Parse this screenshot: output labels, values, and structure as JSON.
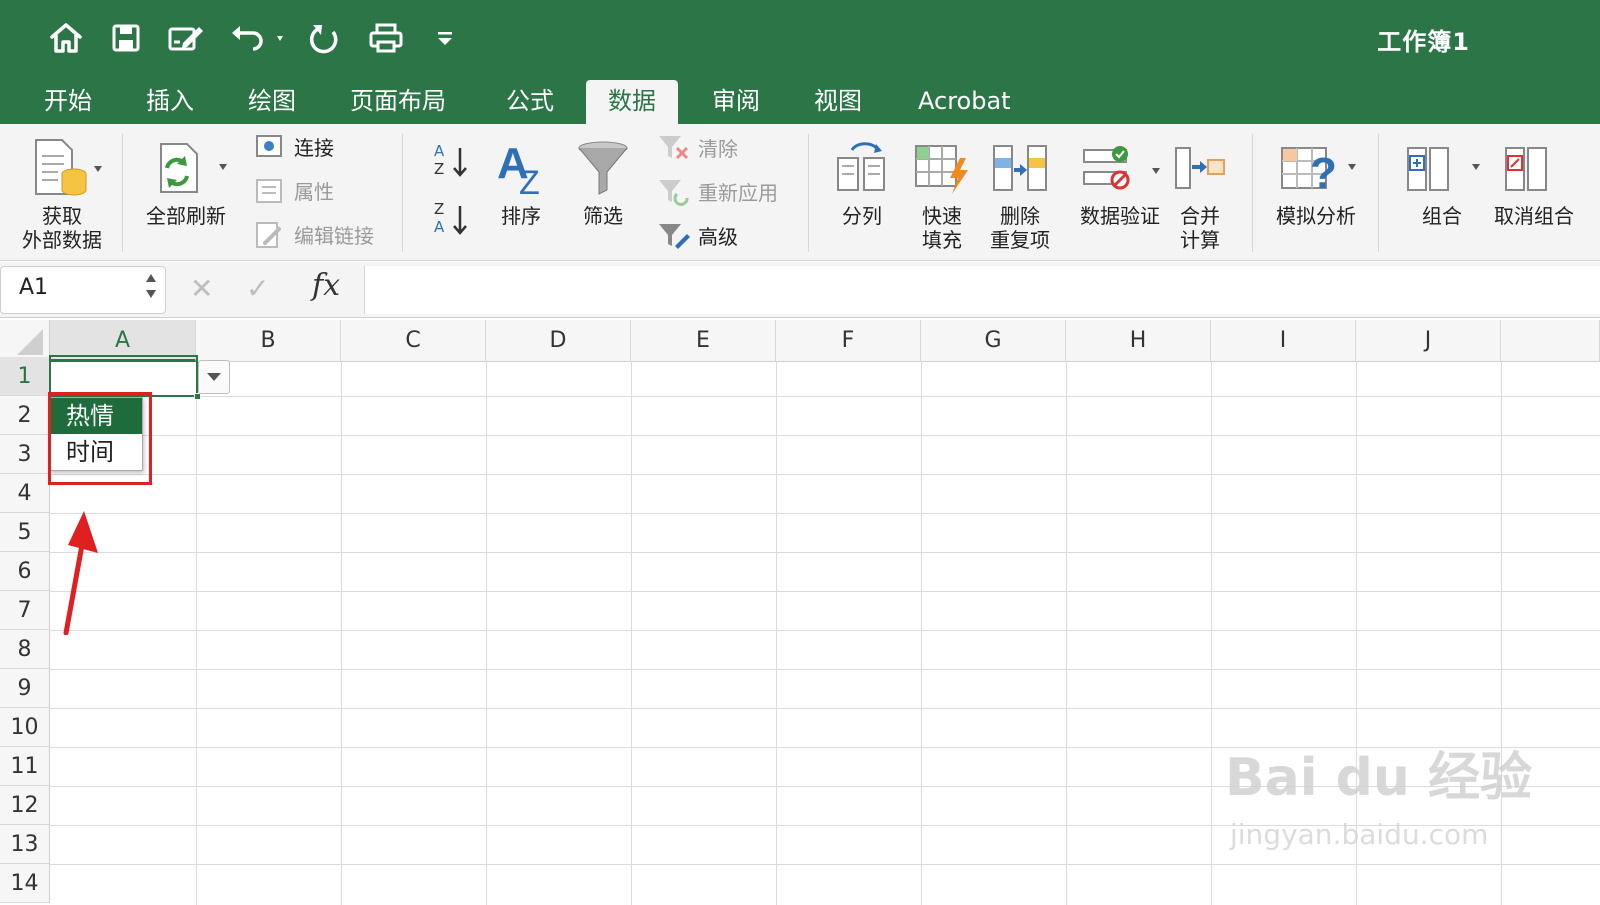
{
  "window": {
    "title": "工作簿1"
  },
  "quick_access": [
    {
      "icon": "home-icon"
    },
    {
      "icon": "save-icon"
    },
    {
      "icon": "edit-icon"
    },
    {
      "icon": "undo-icon"
    },
    {
      "icon": "redo-icon"
    },
    {
      "icon": "print-icon"
    },
    {
      "icon": "customize-icon"
    }
  ],
  "tabs": [
    {
      "label": "开始"
    },
    {
      "label": "插入"
    },
    {
      "label": "绘图"
    },
    {
      "label": "页面布局"
    },
    {
      "label": "公式"
    },
    {
      "label": "数据",
      "active": true
    },
    {
      "label": "审阅"
    },
    {
      "label": "视图"
    },
    {
      "label": "Acrobat"
    }
  ],
  "ribbon": {
    "get_external_data": "获取\n外部数据",
    "refresh_all": "全部刷新",
    "connections": "连接",
    "properties": "属性",
    "edit_links": "编辑链接",
    "sort": "排序",
    "filter": "筛选",
    "clear": "清除",
    "reapply": "重新应用",
    "advanced": "高级",
    "text_to_columns": "分列",
    "flash_fill": "快速\n填充",
    "remove_duplicates": "删除\n重复项",
    "data_validation": "数据验证",
    "consolidate": "合并\n计算",
    "what_if": "模拟分析",
    "group": "组合",
    "ungroup": "取消组合",
    "sort_az_top": "A",
    "sort_az_bottom": "Z",
    "sort_za_top": "Z",
    "sort_za_bottom": "A"
  },
  "formula_bar": {
    "name_box": "A1",
    "fx_label": "fx",
    "formula": ""
  },
  "sheet": {
    "columns": [
      "A",
      "B",
      "C",
      "D",
      "E",
      "F",
      "G",
      "H",
      "I",
      "J"
    ],
    "rows": [
      "1",
      "2",
      "3",
      "4",
      "5",
      "6",
      "7",
      "8",
      "9",
      "10",
      "11",
      "12",
      "13",
      "14"
    ],
    "selected_cell": "A1"
  },
  "dropdown": {
    "options": [
      "热情",
      "时间"
    ],
    "highlighted": "热情"
  },
  "watermark": {
    "line1": "Bai du 经验",
    "line2": "jingyan.baidu.com"
  },
  "colors": {
    "accent": "#2b7547",
    "annotation": "#e02020"
  }
}
